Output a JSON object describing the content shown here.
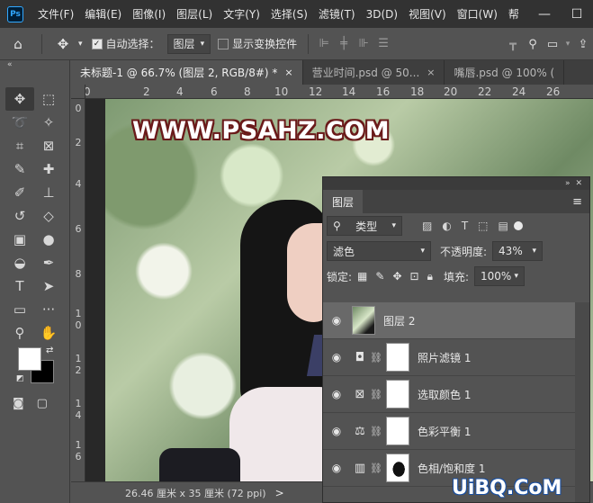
{
  "app": {
    "logo": "Ps"
  },
  "menu": [
    "文件(F)",
    "编辑(E)",
    "图像(I)",
    "图层(L)",
    "文字(Y)",
    "选择(S)",
    "滤镜(T)",
    "3D(D)",
    "视图(V)",
    "窗口(W)",
    "帮"
  ],
  "window_controls": {
    "minimize": "—",
    "maximize": "☐"
  },
  "options_bar": {
    "auto_select_label": "自动选择：",
    "auto_select_checked": true,
    "auto_select_target": "图层",
    "show_transform_label": "显示变换控件",
    "show_transform_checked": false
  },
  "tabs": [
    {
      "label": "未标题-1 @ 66.7% (图层 2, RGB/8#) *",
      "close": "×",
      "active": true
    },
    {
      "label": "营业时间.psd @ 50...",
      "close": "×",
      "active": false
    },
    {
      "label": "嘴唇.psd @ 100% (",
      "active": false
    }
  ],
  "ruler_top": [
    "0",
    "2",
    "4",
    "6",
    "8",
    "10",
    "12",
    "14",
    "16",
    "18",
    "20",
    "22",
    "24",
    "26"
  ],
  "ruler_left": [
    "0",
    "2",
    "4",
    "6",
    "8",
    "1 0",
    "1 2",
    "1 4",
    "1 6"
  ],
  "canvas": {
    "watermark": "WWW.PSAHZ.COM"
  },
  "status": {
    "dimensions": "26.46 厘米 x 35 厘米 (72 ppi)",
    "chevron": ">"
  },
  "layers_panel": {
    "title": "图层",
    "filter_type": "类型",
    "blend_mode": "滤色",
    "opacity_label": "不透明度:",
    "opacity_value": "43%",
    "lock_label": "锁定:",
    "fill_label": "填充:",
    "fill_value": "100%",
    "layers": [
      {
        "name": "图层 2",
        "type": "pixel",
        "selected": true
      },
      {
        "name": "照片滤镜 1",
        "type": "photo-filter",
        "selected": false
      },
      {
        "name": "选取颜色 1",
        "type": "selective-color",
        "selected": false
      },
      {
        "name": "色彩平衡 1",
        "type": "color-balance",
        "selected": false
      },
      {
        "name": "色相/饱和度 1",
        "type": "hue-saturation",
        "selected": false
      }
    ]
  },
  "corner_watermark": "UiBQ.CoM"
}
